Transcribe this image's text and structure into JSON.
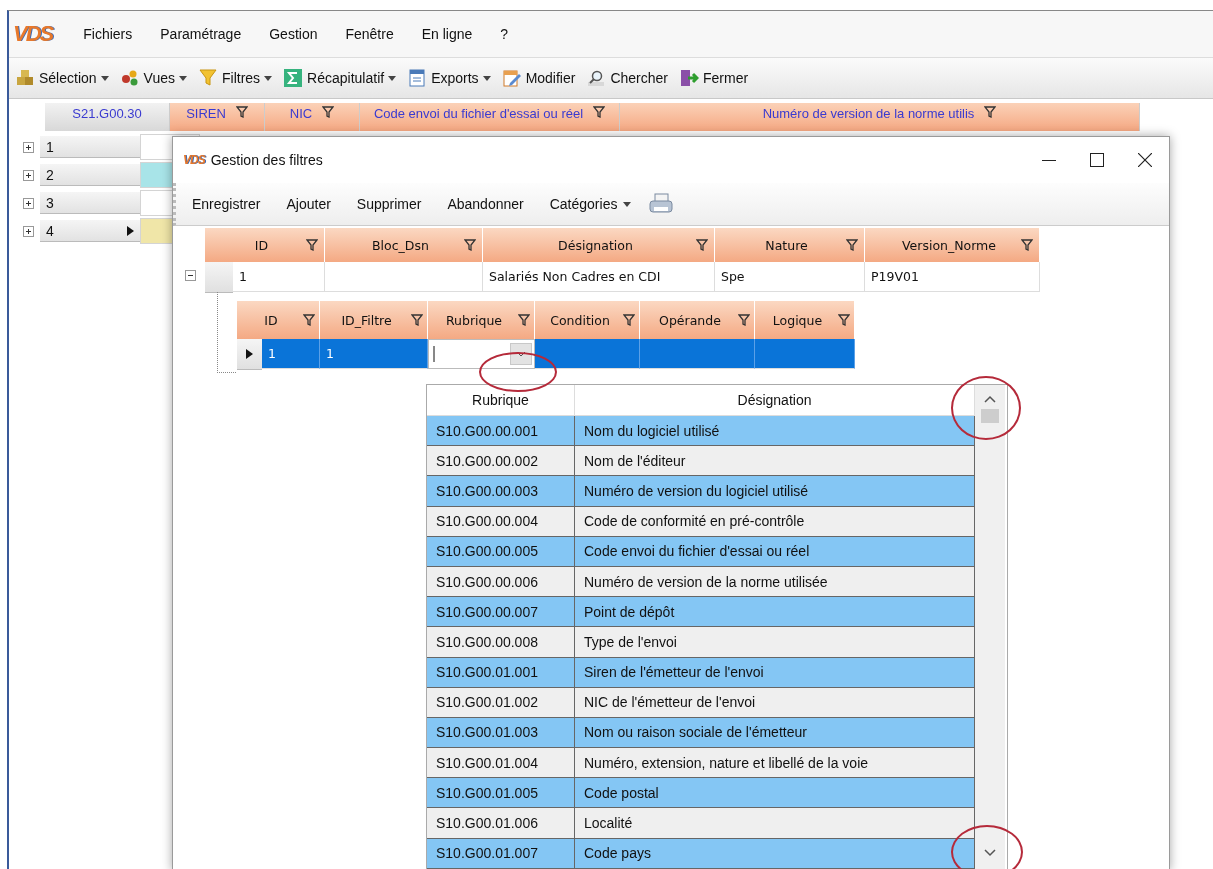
{
  "app": {
    "logo": "VDS",
    "menu": [
      {
        "label": "Fichiers"
      },
      {
        "label": "Paramétrage"
      },
      {
        "label": "Gestion"
      },
      {
        "label": "Fenêtre"
      },
      {
        "label": "En ligne"
      },
      {
        "label": "?"
      }
    ],
    "toolbar": [
      {
        "label": "Sélection",
        "dropdown": true
      },
      {
        "label": "Vues",
        "dropdown": true
      },
      {
        "label": "Filtres",
        "dropdown": true
      },
      {
        "label": "Récapitulatif",
        "dropdown": true
      },
      {
        "label": "Exports",
        "dropdown": true
      },
      {
        "label": "Modifier",
        "dropdown": false
      },
      {
        "label": "Chercher",
        "dropdown": false
      },
      {
        "label": "Fermer",
        "dropdown": false
      }
    ],
    "grid": {
      "columns": [
        {
          "label": "S21.G00.30",
          "kind": "group"
        },
        {
          "label": "SIREN",
          "kind": "field"
        },
        {
          "label": "NIC",
          "kind": "field"
        },
        {
          "label": "Code envoi du fichier d'essai ou réel",
          "kind": "field"
        },
        {
          "label": "Numéro de version de la norme utilis",
          "kind": "field"
        }
      ],
      "rows": [
        {
          "label": "1",
          "current": false,
          "color": "#ffffff"
        },
        {
          "label": "2",
          "current": false,
          "color": "#a8e4e8"
        },
        {
          "label": "3",
          "current": false,
          "color": "#ffffff"
        },
        {
          "label": "4",
          "current": true,
          "color": "#f0e6a8"
        }
      ]
    }
  },
  "dialog": {
    "logo": "VDS",
    "title": "Gestion des filtres",
    "toolbar": [
      {
        "label": "Enregistrer",
        "dropdown": false
      },
      {
        "label": "Ajouter",
        "dropdown": false
      },
      {
        "label": "Supprimer",
        "dropdown": false
      },
      {
        "label": "Abandonner",
        "dropdown": false
      },
      {
        "label": "Catégories",
        "dropdown": true
      }
    ],
    "master_grid": {
      "columns": [
        "ID",
        "Bloc_Dsn",
        "Désignation",
        "Nature",
        "Version_Norme"
      ],
      "rows": [
        {
          "id": "1",
          "designation": "Salariés Non Cadres en CDI",
          "nature": "Spe",
          "version_norme": "P19V01",
          "expanded": true
        }
      ]
    },
    "detail_grid": {
      "columns": [
        "ID",
        "ID_Filtre",
        "Rubrique",
        "Condition",
        "Opérande",
        "Logique"
      ],
      "rows": [
        {
          "id": "1",
          "id_filtre": "1",
          "current": true
        }
      ]
    },
    "lookup": {
      "columns": [
        "Rubrique",
        "Désignation"
      ],
      "rows": [
        {
          "rubrique": "S10.G00.00.001",
          "designation": "Nom du logiciel utilisé"
        },
        {
          "rubrique": "S10.G00.00.002",
          "designation": "Nom de l'éditeur"
        },
        {
          "rubrique": "S10.G00.00.003",
          "designation": "Numéro de version du logiciel utilisé"
        },
        {
          "rubrique": "S10.G00.00.004",
          "designation": "Code de conformité en pré-contrôle"
        },
        {
          "rubrique": "S10.G00.00.005",
          "designation": "Code envoi du fichier d'essai ou réel"
        },
        {
          "rubrique": "S10.G00.00.006",
          "designation": "Numéro de version de la norme utilisée"
        },
        {
          "rubrique": "S10.G00.00.007",
          "designation": "Point de dépôt"
        },
        {
          "rubrique": "S10.G00.00.008",
          "designation": "Type de l'envoi"
        },
        {
          "rubrique": "S10.G00.01.001",
          "designation": "Siren de l'émetteur de l'envoi"
        },
        {
          "rubrique": "S10.G00.01.002",
          "designation": "NIC de l'émetteur de l'envoi"
        },
        {
          "rubrique": "S10.G00.01.003",
          "designation": "Nom ou raison sociale de l'émetteur"
        },
        {
          "rubrique": "S10.G00.01.004",
          "designation": "Numéro, extension, nature et libellé de la voie"
        },
        {
          "rubrique": "S10.G00.01.005",
          "designation": "Code postal"
        },
        {
          "rubrique": "S10.G00.01.006",
          "designation": "Localité"
        },
        {
          "rubrique": "S10.G00.01.007",
          "designation": "Code pays"
        }
      ]
    }
  }
}
